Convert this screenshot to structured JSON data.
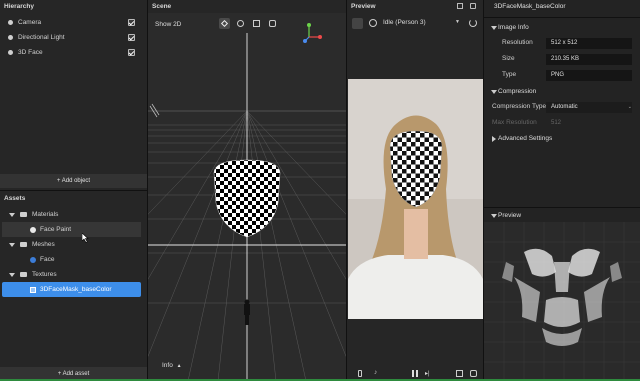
{
  "hierarchy": {
    "title": "Hierarchy",
    "items": [
      {
        "label": "Camera"
      },
      {
        "label": "Directional Light"
      },
      {
        "label": "3D Face"
      }
    ],
    "add_label": "+ Add object"
  },
  "assets": {
    "title": "Assets",
    "materials": {
      "label": "Materials",
      "items": [
        "Face Paint"
      ]
    },
    "meshes": {
      "label": "Meshes",
      "items": [
        "Face"
      ]
    },
    "textures": {
      "label": "Textures",
      "items": [
        "3DFaceMask_baseColor"
      ]
    },
    "add_label": "+ Add asset"
  },
  "scene": {
    "title": "Scene",
    "mode_label": "Show 2D",
    "info_label": "Info"
  },
  "preview": {
    "title": "Preview",
    "person_select": "Idle (Person 3)"
  },
  "inspector": {
    "asset_name": "3DFaceMask_baseColor",
    "image_info": {
      "title": "Image Info",
      "resolution_label": "Resolution",
      "resolution": "512 x 512",
      "size_label": "Size",
      "size": "210.35 KB",
      "type_label": "Type",
      "type": "PNG"
    },
    "compression": {
      "title": "Compression",
      "type_label": "Compression Type",
      "type": "Automatic",
      "max_res_label": "Max Resolution",
      "max_res": "512"
    },
    "advanced_label": "Advanced Settings",
    "preview_title": "Preview"
  },
  "colors": {
    "accent": "#4a9fff",
    "selected_row": "#3d8eea"
  }
}
